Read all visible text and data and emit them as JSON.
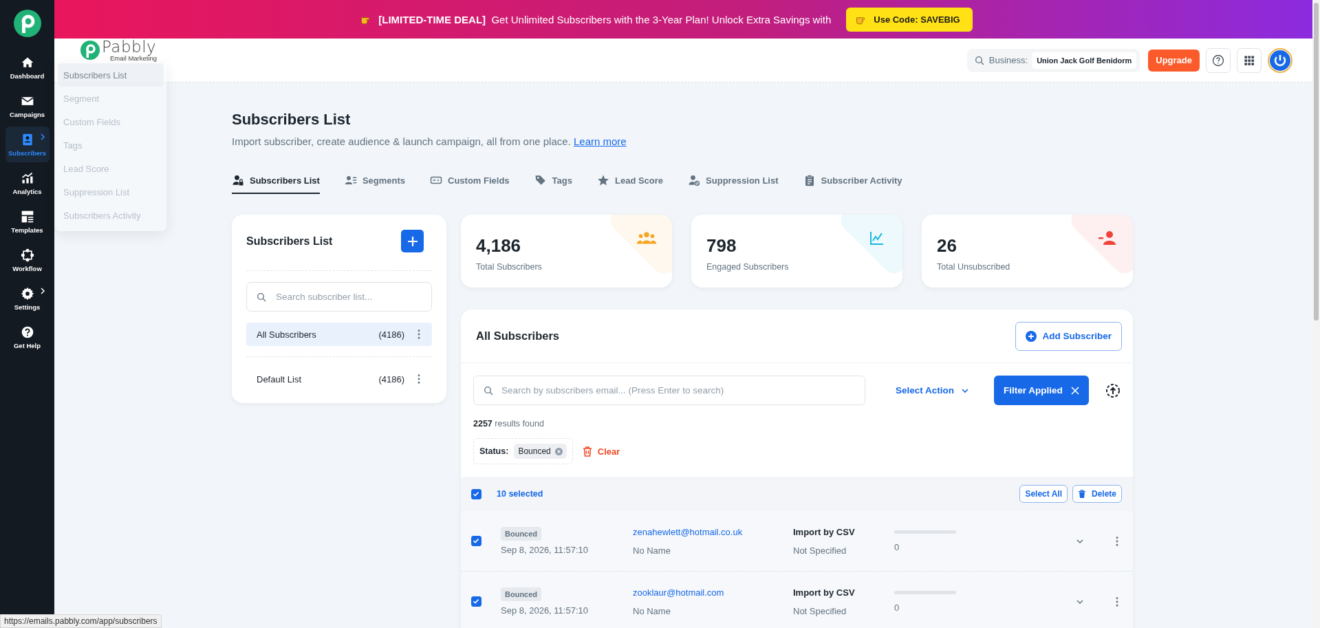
{
  "banner": {
    "deal": "[LIMITED-TIME DEAL]",
    "text": "Get Unlimited Subscribers with the 3-Year Plan! Unlock Extra Savings with",
    "code_button": "Use Code: SAVEBIG"
  },
  "sidebar": {
    "items": [
      {
        "label": "Dashboard",
        "kind": "home",
        "selected": false,
        "has_submenu": false
      },
      {
        "label": "Campaigns",
        "kind": "mail",
        "selected": false,
        "has_submenu": false
      },
      {
        "label": "Subscribers",
        "kind": "contacts",
        "selected": true,
        "has_submenu": true
      },
      {
        "label": "Analytics",
        "kind": "chart",
        "selected": false,
        "has_submenu": false
      },
      {
        "label": "Templates",
        "kind": "layout",
        "selected": false,
        "has_submenu": false
      },
      {
        "label": "Workflow",
        "kind": "workflow",
        "selected": false,
        "has_submenu": false
      },
      {
        "label": "Settings",
        "kind": "gear",
        "selected": false,
        "has_submenu": true
      },
      {
        "label": "Get Help",
        "kind": "help",
        "selected": false,
        "has_submenu": false
      }
    ]
  },
  "submenu": {
    "items": [
      {
        "label": "Subscribers List",
        "selected": true
      },
      {
        "label": "Segment",
        "selected": false
      },
      {
        "label": "Custom Fields",
        "selected": false
      },
      {
        "label": "Tags",
        "selected": false
      },
      {
        "label": "Lead Score",
        "selected": false
      },
      {
        "label": "Suppression List",
        "selected": false
      },
      {
        "label": "Subscribers Activity",
        "selected": false
      }
    ]
  },
  "logo": {
    "name": "Pabbly",
    "tagline": "Email Marketing"
  },
  "header": {
    "business_label": "Business:",
    "business_name": "Union Jack Golf Benidorm",
    "upgrade_button": "Upgrade"
  },
  "page": {
    "title": "Subscribers List",
    "description": "Import subscriber, create audience & launch campaign, all from one place.",
    "link": "Learn more"
  },
  "tabs": [
    {
      "label": "Subscribers List",
      "kind": "user-lock",
      "selected": true
    },
    {
      "label": "Segments",
      "kind": "user-list",
      "selected": false
    },
    {
      "label": "Custom Fields",
      "kind": "field",
      "selected": false
    },
    {
      "label": "Tags",
      "kind": "tag",
      "selected": false
    },
    {
      "label": "Lead Score",
      "kind": "star",
      "selected": false
    },
    {
      "label": "Suppression List",
      "kind": "user-block",
      "selected": false
    },
    {
      "label": "Subscriber Activity",
      "kind": "clipboard",
      "selected": false
    }
  ],
  "list_panel": {
    "title": "Subscribers List",
    "search_placeholder": "Search subscriber list...",
    "lists": [
      {
        "name": "All Subscribers",
        "count": "(4186)",
        "selected": true
      },
      {
        "name": "Default List",
        "count": "(4186)",
        "selected": false
      }
    ]
  },
  "stats": [
    {
      "value": "4,186",
      "label": "Total Subscribers",
      "kind": "people",
      "color": "#f5a524"
    },
    {
      "value": "798",
      "label": "Engaged Subscribers",
      "kind": "trend",
      "color": "#16b8e0"
    },
    {
      "value": "26",
      "label": "Total Unsubscribed",
      "kind": "user-minus",
      "color": "#f0443a"
    }
  ],
  "table": {
    "title": "All Subscribers",
    "add_button": "Add Subscriber",
    "search_placeholder": "Search by subscribers email... (Press Enter to search)",
    "select_action": "Select Action",
    "filter_button": "Filter Applied",
    "results_count": "2257",
    "results_text": "results found",
    "filter_label": "Status:",
    "filter_value": "Bounced",
    "clear_button": "Clear",
    "all_checked": true,
    "selected_text": "10 selected",
    "select_all_button": "Select All",
    "delete_button": "Delete",
    "rows": [
      {
        "checked": true,
        "status": "Bounced",
        "date": "Sep 8, 2026, 11:57:10",
        "email": "zenahewlett@hotmail.co.uk",
        "name": "No Name",
        "source": "Import by CSV",
        "detail": "Not Specified",
        "level": 0,
        "score": "0"
      },
      {
        "checked": true,
        "status": "Bounced",
        "date": "Sep 8, 2026, 11:57:10",
        "email": "zooklaur@hotmail.com",
        "name": "No Name",
        "source": "Import by CSV",
        "detail": "Not Specified",
        "level": 0,
        "score": "0"
      }
    ]
  },
  "status_url": "https://emails.pabbly.com/app/subscribers"
}
